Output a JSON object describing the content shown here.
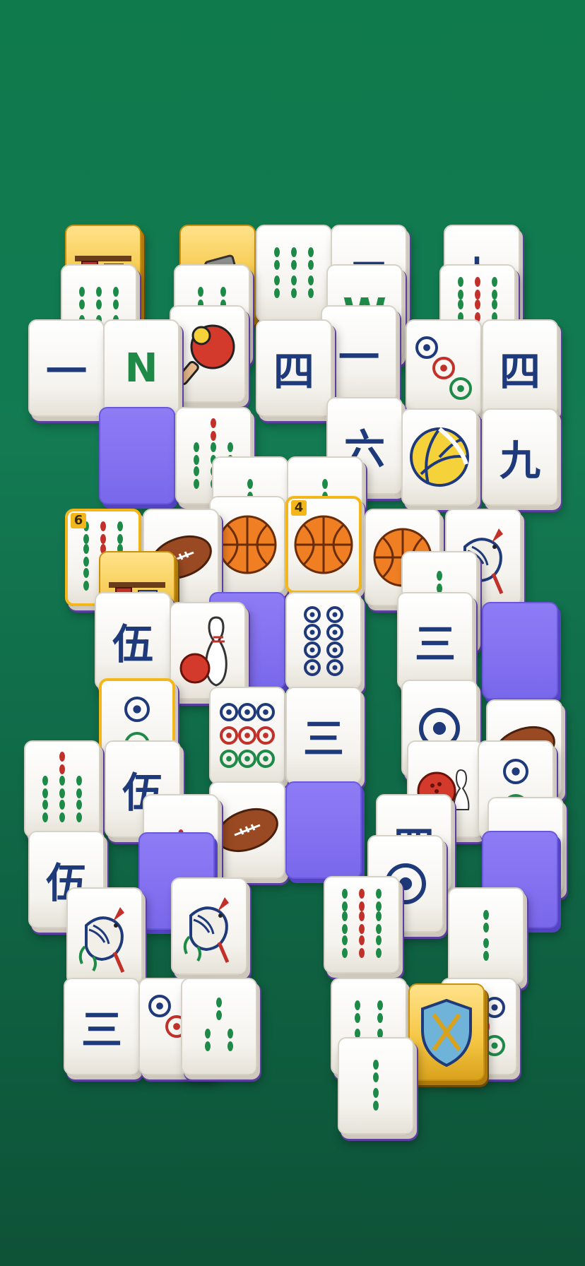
{
  "game": {
    "title": "",
    "colors": {
      "felt_top": "#0f7a4c",
      "felt_bottom": "#0e5238",
      "tile_face": "#ffffff",
      "tile_side": "#5b3ea0",
      "empty_slot": "#8e7cf5",
      "highlight": "#f4b71b",
      "ink_blue": "#1f3a7a",
      "ink_green": "#1e8a48",
      "ink_red": "#c2302a"
    }
  },
  "tiles": [
    {
      "icon": "banner-icon",
      "kind": "gold"
    },
    {
      "icon": "hammer-icon",
      "kind": "gold"
    },
    {
      "icon": "bamboo-6-icon"
    },
    {
      "icon": "character-icon",
      "text": "二"
    },
    {
      "icon": "character-icon",
      "text": "七"
    },
    {
      "icon": "bamboo-6-icon"
    },
    {
      "icon": "bamboo-4-icon"
    },
    {
      "icon": "west-wind-icon",
      "text": "W"
    },
    {
      "icon": "bamboo-9-icon"
    },
    {
      "icon": "character-icon",
      "text": "一"
    },
    {
      "icon": "north-wind-icon",
      "text": "N"
    },
    {
      "icon": "ping-pong-icon"
    },
    {
      "icon": "character-icon",
      "text": "四"
    },
    {
      "icon": "character-icon",
      "text": "一"
    },
    {
      "icon": "circle-3-icon"
    },
    {
      "icon": "character-icon",
      "text": "四"
    },
    {
      "icon": "empty-slot",
      "kind": "empty"
    },
    {
      "icon": "bamboo-7-icon"
    },
    {
      "icon": "character-icon",
      "text": "六"
    },
    {
      "icon": "volleyball-icon"
    },
    {
      "icon": "character-icon",
      "text": "九"
    },
    {
      "icon": "bamboo-2-icon"
    },
    {
      "icon": "bamboo-2-icon"
    },
    {
      "icon": "bamboo-9-icon",
      "badge": "6",
      "kind": "hl"
    },
    {
      "icon": "football-icon"
    },
    {
      "icon": "basketball-icon"
    },
    {
      "icon": "basketball-icon",
      "badge": "4",
      "kind": "hl"
    },
    {
      "icon": "basketball-icon"
    },
    {
      "icon": "bird-icon"
    },
    {
      "icon": "banner-icon",
      "kind": "gold"
    },
    {
      "icon": "bamboo-3-icon"
    },
    {
      "icon": "character-icon",
      "text": "伍"
    },
    {
      "icon": "bowling-icon"
    },
    {
      "icon": "empty-slot",
      "kind": "empty"
    },
    {
      "icon": "circle-8-icon"
    },
    {
      "icon": "character-icon",
      "text": "三"
    },
    {
      "icon": "empty-slot",
      "kind": "empty"
    },
    {
      "icon": "circle-2-icon",
      "kind": "hl"
    },
    {
      "icon": "circle-9-icon"
    },
    {
      "icon": "character-icon",
      "text": "三"
    },
    {
      "icon": "circle-1-icon"
    },
    {
      "icon": "football-icon"
    },
    {
      "icon": "bamboo-7-icon"
    },
    {
      "icon": "character-icon",
      "text": "伍"
    },
    {
      "icon": "bowling-ball-icon"
    },
    {
      "icon": "circle-2-icon"
    },
    {
      "icon": "bamboo-1-icon"
    },
    {
      "icon": "football-icon"
    },
    {
      "icon": "empty-slot",
      "kind": "empty"
    },
    {
      "icon": "character-icon",
      "text": "四"
    },
    {
      "icon": "character-icon",
      "text": "伍"
    },
    {
      "icon": "empty-slot",
      "kind": "empty"
    },
    {
      "icon": "circle-1-icon"
    },
    {
      "icon": "character-icon",
      "text": "四"
    },
    {
      "icon": "bird-icon"
    },
    {
      "icon": "bird-icon"
    },
    {
      "icon": "empty-slot",
      "kind": "empty"
    },
    {
      "icon": "bamboo-9-icon"
    },
    {
      "icon": "bamboo-2-icon"
    },
    {
      "icon": "character-icon",
      "text": "三"
    },
    {
      "icon": "circle-3-icon"
    },
    {
      "icon": "bamboo-3-icon"
    },
    {
      "icon": "bamboo-4-icon"
    },
    {
      "icon": "shield-icon",
      "kind": "gold"
    },
    {
      "icon": "circle-5-icon"
    },
    {
      "icon": "bamboo-2-icon"
    }
  ]
}
